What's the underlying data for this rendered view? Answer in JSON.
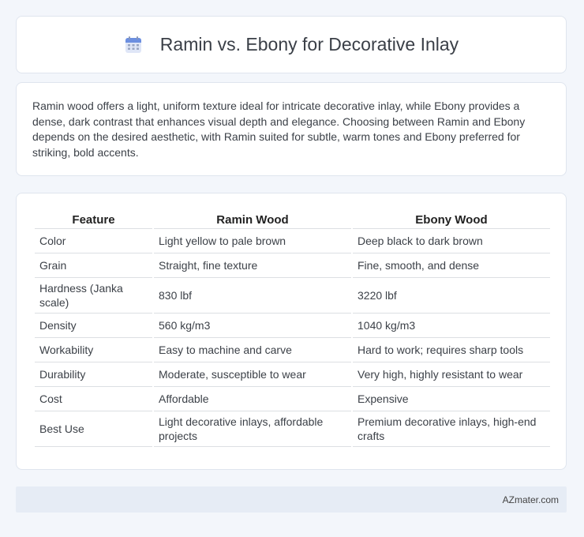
{
  "header": {
    "title": "Ramin vs. Ebony for Decorative Inlay",
    "icon": "calendar-icon"
  },
  "intro": "Ramin wood offers a light, uniform texture ideal for intricate decorative inlay, while Ebony provides a dense, dark contrast that enhances visual depth and elegance. Choosing between Ramin and Ebony depends on the desired aesthetic, with Ramin suited for subtle, warm tones and Ebony preferred for striking, bold accents.",
  "table": {
    "headers": [
      "Feature",
      "Ramin Wood",
      "Ebony Wood"
    ],
    "rows": [
      [
        "Color",
        "Light yellow to pale brown",
        "Deep black to dark brown"
      ],
      [
        "Grain",
        "Straight, fine texture",
        "Fine, smooth, and dense"
      ],
      [
        "Hardness (Janka scale)",
        "830 lbf",
        "3220 lbf"
      ],
      [
        "Density",
        "560 kg/m3",
        "1040 kg/m3"
      ],
      [
        "Workability",
        "Easy to machine and carve",
        "Hard to work; requires sharp tools"
      ],
      [
        "Durability",
        "Moderate, susceptible to wear",
        "Very high, highly resistant to wear"
      ],
      [
        "Cost",
        "Affordable",
        "Expensive"
      ],
      [
        "Best Use",
        "Light decorative inlays, affordable projects",
        "Premium decorative inlays, high-end crafts"
      ]
    ]
  },
  "footer": {
    "brand": "AZmater.com"
  }
}
